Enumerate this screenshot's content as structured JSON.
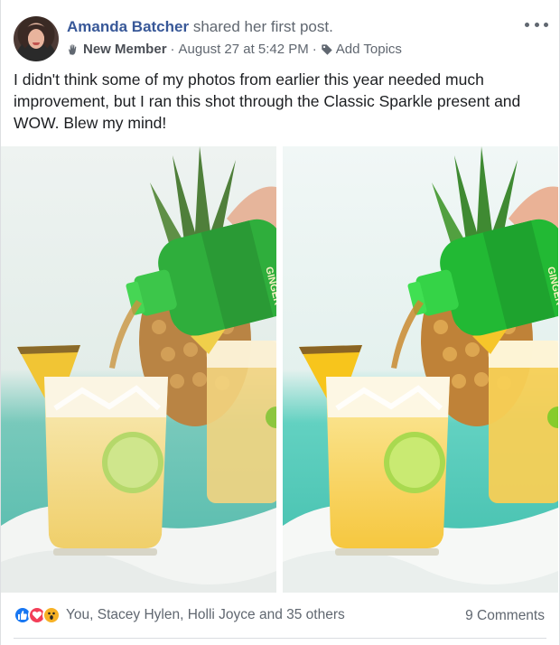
{
  "post": {
    "author": "Amanda Batcher",
    "action": "shared her first post.",
    "badge": "New Member",
    "separator": "·",
    "timestamp": "August 27 at 5:42 PM",
    "add_topics": "Add Topics",
    "text": "I didn't think some of my photos from earlier this year needed much improvement, but I ran this shot through the Classic Sparkle present and WOW. Blew my mind!",
    "bottle_label": "GINGER"
  },
  "footer": {
    "reactions_summary": "You, Stacey Hylen, Holli Joyce and 35 others",
    "comments": "9 Comments",
    "reaction_icons": [
      "like-icon",
      "love-icon",
      "wow-icon"
    ]
  },
  "colors": {
    "link": "#385898",
    "secondary_text": "#606770",
    "like": "#1877f2",
    "love": "#f33e58",
    "wow": "#f7b125",
    "bottle_green": "#2fae3c",
    "drink_yellow": "#f3d77a",
    "background_teal": "#5cc7b8"
  }
}
